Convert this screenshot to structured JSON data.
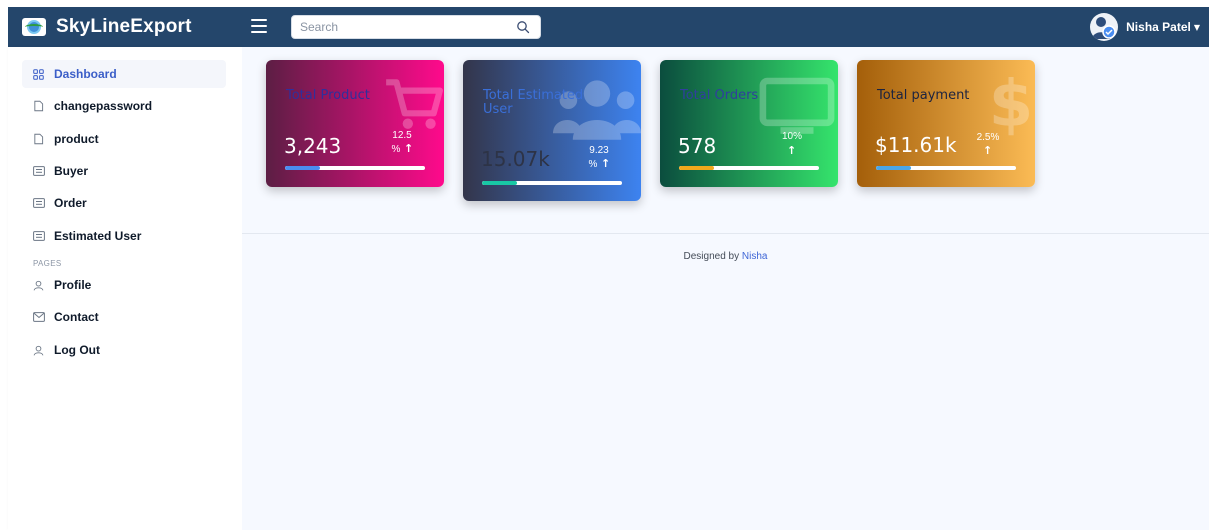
{
  "header": {
    "brand": "SkyLineExport",
    "search_placeholder": "Search",
    "user_name": "Nisha Patel"
  },
  "sidebar": {
    "items": [
      {
        "label": "Dashboard",
        "icon": "grid-icon",
        "active": true
      },
      {
        "label": "changepassword",
        "icon": "file-icon"
      },
      {
        "label": "product",
        "icon": "file-icon"
      },
      {
        "label": "Buyer",
        "icon": "list-icon"
      },
      {
        "label": "Order",
        "icon": "list-icon"
      },
      {
        "label": "Estimated User",
        "icon": "list-icon"
      }
    ],
    "section_pages": "PAGES",
    "pages": [
      {
        "label": "Profile",
        "icon": "user-icon"
      },
      {
        "label": "Contact",
        "icon": "mail-icon"
      },
      {
        "label": "Log Out",
        "icon": "logout-icon"
      }
    ]
  },
  "cards": [
    {
      "title": "Total Product",
      "value": "3,243",
      "change_top": "12.5",
      "change_bottom": "%",
      "arrow": "↑",
      "progress": 0.25,
      "bg_icon": "cart-icon",
      "colors": [
        "#5c1e44",
        "#ff0a8c"
      ],
      "bar_color": "#4a8df0",
      "title_color": "#2f2f9c"
    },
    {
      "title": "Total Estimated User",
      "value": "15.07k",
      "change_top": "9.23",
      "change_bottom": "%",
      "arrow": "↑",
      "progress": 0.25,
      "bg_icon": "users-icon",
      "colors": [
        "#33354a",
        "#3d83f0"
      ],
      "bar_color": "#19c8a5",
      "title_color": "#3a6fd8"
    },
    {
      "title": "Total Orders",
      "value": "578",
      "change_top": "10%",
      "change_bottom": "",
      "arrow": "↑",
      "progress": 0.25,
      "bg_icon": "monitor-icon",
      "colors": [
        "#0b4d3e",
        "#35e46c"
      ],
      "bar_color": "#f2a81c",
      "title_color": "#2f3f9c"
    },
    {
      "title": "Total payment",
      "value": "$11.61k",
      "change_top": "2.5%",
      "change_bottom": "",
      "arrow": "↑",
      "progress": 0.25,
      "bg_icon": "dollar-icon",
      "colors": [
        "#a45f0a",
        "#fbbb55"
      ],
      "bar_color": "#4aa6e8",
      "title_color": "#1c2340"
    }
  ],
  "footer": {
    "text": "Designed by ",
    "link": "Nisha"
  }
}
